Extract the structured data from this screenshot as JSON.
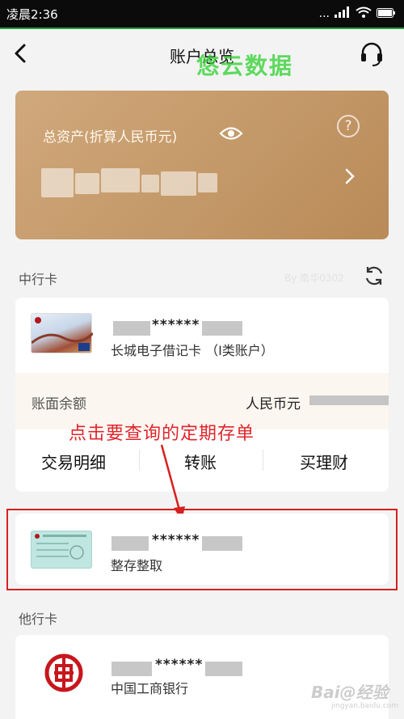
{
  "status_bar": {
    "time": "凌晨2:36",
    "signal_text": "...",
    "icons": [
      "signal-icon",
      "wifi-icon",
      "battery-icon"
    ]
  },
  "nav": {
    "title": "账户总览",
    "back_icon": "chevron-left-icon",
    "service_icon": "headset-icon"
  },
  "watermark": "悠云数据",
  "asset_card": {
    "label": "总资产(折算人民币元)",
    "help_symbol": "?",
    "eye_icon": "eye-icon",
    "amount_masked": true
  },
  "boc_section": {
    "title": "中行卡",
    "faint_text": "By 南华0302",
    "refresh_icon": "refresh-icon",
    "debit_card": {
      "masked_number": "******",
      "name": "长城电子借记卡 （I类账户）"
    },
    "balance": {
      "label": "账面余额",
      "currency": "人民币元"
    },
    "actions": [
      "交易明细",
      "转账",
      "买理财"
    ],
    "deposit": {
      "masked_number": "******",
      "name": "整存整取"
    }
  },
  "annotation": "点击要查询的定期存单",
  "other_section": {
    "title": "他行卡",
    "card": {
      "masked_number": "******",
      "name": "中国工商银行"
    }
  },
  "footer_watermark": {
    "brand": "Bai@经验",
    "url": "jingyan.baidu.com"
  },
  "colors": {
    "accent_green": "#1ca33b",
    "gold": "#c59a6a",
    "annotation_red": "#e0262b"
  }
}
